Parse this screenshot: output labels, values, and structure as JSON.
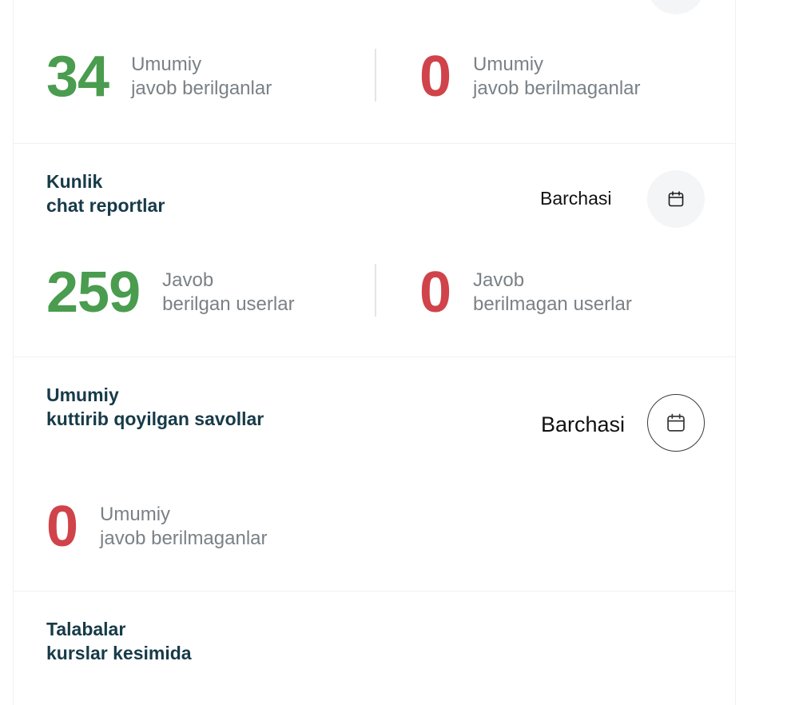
{
  "cards": {
    "answered_total": {
      "title_line1": "",
      "answered_value": "34",
      "answered_label_line1": "Umumiy",
      "answered_label_line2": "javob berilganlar",
      "unanswered_value": "0",
      "unanswered_label_line1": "Umumiy",
      "unanswered_label_line2": "javob berilmaganlar"
    },
    "daily_chat": {
      "title_line1": "Kunlik",
      "title_line2": "chat reportlar",
      "filter_label": "Barchasi",
      "answered_value": "259",
      "answered_label_line1": "Javob",
      "answered_label_line2": "berilgan userlar",
      "unanswered_value": "0",
      "unanswered_label_line1": "Javob",
      "unanswered_label_line2": "berilmagan userlar"
    },
    "pending_questions": {
      "title_line1": "Umumiy",
      "title_line2": "kuttirib qoyilgan savollar",
      "filter_label": "Barchasi",
      "unanswered_value": "0",
      "unanswered_label_line1": "Umumiy",
      "unanswered_label_line2": "javob berilmaganlar"
    },
    "students_by_course": {
      "title_line1": "Talabalar",
      "title_line2": "kurslar kesimida"
    }
  },
  "icons": {
    "calendar": "calendar-icon"
  },
  "colors": {
    "title": "#173a48",
    "positive": "#4a9c4f",
    "negative": "#d0434a",
    "muted_text": "#7a8186"
  }
}
